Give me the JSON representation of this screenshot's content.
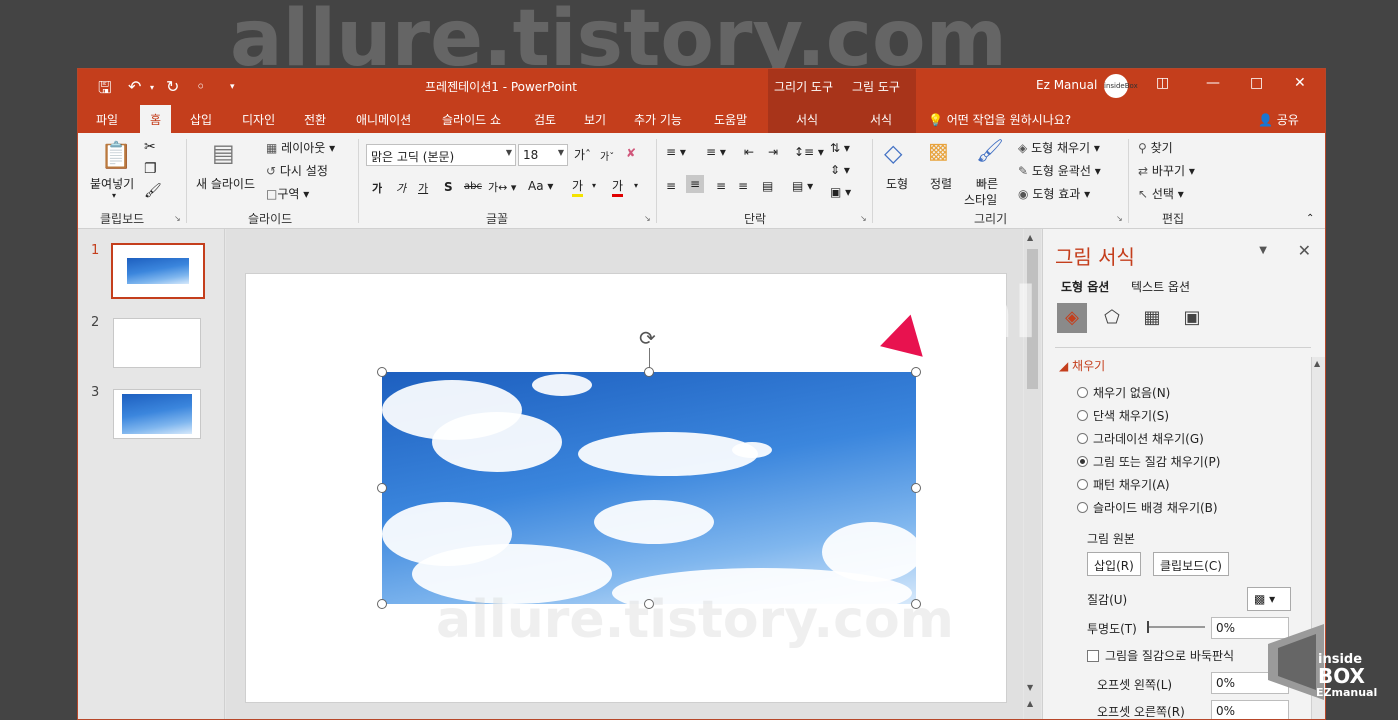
{
  "window": {
    "title": "프레젠테이션1  -  PowerPoint",
    "context_groups": [
      "그리기 도구",
      "그림 도구"
    ],
    "user": "Ez Manual",
    "avatar_text": "insideBox"
  },
  "tabs": [
    "파일",
    "홈",
    "삽입",
    "디자인",
    "전환",
    "애니메이션",
    "슬라이드 쇼",
    "검토",
    "보기",
    "추가 기능",
    "도움말"
  ],
  "context_tabs": [
    "서식",
    "서식"
  ],
  "tell_me": "어떤 작업을 원하시나요?",
  "share": "공유",
  "ribbon": {
    "clipboard": {
      "paste": "붙여넣기",
      "label": "클립보드"
    },
    "slides": {
      "new_slide": "새 슬라이드",
      "layout": "레이아웃",
      "reset": "다시 설정",
      "section": "구역",
      "label": "슬라이드"
    },
    "font": {
      "name": "맑은 고딕 (본문)",
      "size": "18",
      "label": "글꼴"
    },
    "paragraph": {
      "label": "단락"
    },
    "drawing": {
      "shapes": "도형",
      "arrange": "정렬",
      "quick_styles_1": "빠른",
      "quick_styles_2": "스타일",
      "shape_fill": "도형 채우기",
      "shape_outline": "도형 윤곽선",
      "shape_effects": "도형 효과",
      "label": "그리기"
    },
    "editing": {
      "find": "찾기",
      "replace": "바꾸기",
      "select": "선택",
      "label": "편집"
    }
  },
  "slides": [
    {
      "number": "1"
    },
    {
      "number": "2"
    },
    {
      "number": "3"
    }
  ],
  "format_pane": {
    "title": "그림 서식",
    "tab_shape": "도형 옵션",
    "tab_text": "텍스트 옵션",
    "section": "채우기",
    "fill_options": [
      "채우기 없음(N)",
      "단색 채우기(S)",
      "그라데이션 채우기(G)",
      "그림 또는 질감 채우기(P)",
      "패턴 채우기(A)",
      "슬라이드 배경 채우기(B)"
    ],
    "selected_fill": 3,
    "picture_source": "그림 원본",
    "insert_btn": "삽입(R)",
    "clipboard_btn": "클립보드(C)",
    "texture": "질감(U)",
    "transparency": "투명도(T)",
    "transparency_value": "0%",
    "tile": "그림을 질감으로 바둑판식",
    "offset_left": "오프셋 왼쪽(L)",
    "offset_left_value": "0%",
    "offset_right": "오프셋 오른쪽(R)",
    "offset_right_value": "0%"
  },
  "watermarks": [
    "allure.tistory.com",
    "insideBox Ezmanual",
    "allure.tistory.com"
  ],
  "logo": {
    "line1": "inside",
    "line2": "BOX",
    "line3": "EZmanual"
  },
  "colors": {
    "accent": "#c43e1c",
    "arrow": "#e8124f"
  }
}
